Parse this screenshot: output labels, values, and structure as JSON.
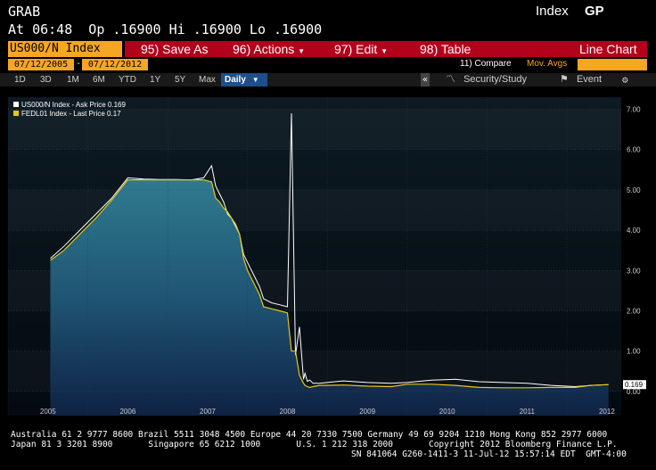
{
  "header": {
    "function": "GRAB",
    "index_label": "Index",
    "gp_label": "GP",
    "quote_line": "At 06:48  Op .16900 Hi .16900 Lo .16900"
  },
  "toolbar": {
    "security": "US000/N Index",
    "save": "95) Save As",
    "actions": "96) Actions",
    "edit": "97) Edit",
    "table": "98) Table",
    "chart_type": "Line Chart"
  },
  "dates": {
    "start": "07/12/2005",
    "end": "07/12/2012",
    "compare": "11) Compare",
    "mov_avgs": "Mov. Avgs"
  },
  "periods": {
    "items": [
      "1D",
      "3D",
      "1M",
      "6M",
      "YTD",
      "1Y",
      "5Y",
      "Max"
    ],
    "frequency": "Daily",
    "collapse": "«",
    "security_study": "Security/Study",
    "event": "Event",
    "gear": "⚙"
  },
  "colors": {
    "toolbar_red": "#b3001b",
    "orange": "#f5a623",
    "series1": "#ffffff",
    "series2": "#e6c619",
    "fill_top": "#2b6f83",
    "fill_bottom": "#0f2244",
    "plot_bg": "#07111a"
  },
  "chart_data": {
    "type": "line",
    "legend": [
      {
        "name": "US000/N Index - Ask Price 0.169",
        "color": "#ffffff"
      },
      {
        "name": "FEDL01 Index - Last Price 0.17",
        "color": "#e6c619"
      }
    ],
    "x_ticks": [
      "2005",
      "2006",
      "2007",
      "2008",
      "2009",
      "2010",
      "2011",
      "2012"
    ],
    "y_ticks": [
      "7.00",
      "6.00",
      "5.00",
      "4.00",
      "3.00",
      "2.00",
      "1.00",
      "0.00"
    ],
    "ylim": [
      -0.6,
      7.3
    ],
    "last_value_label": "0.169",
    "series": [
      {
        "name": "US000/N Index - Ask Price 0.169",
        "x": [
          2005.53,
          2005.7,
          2005.9,
          2006.1,
          2006.3,
          2006.5,
          2006.7,
          2006.9,
          2007.1,
          2007.3,
          2007.45,
          2007.55,
          2007.6,
          2007.65,
          2007.7,
          2007.75,
          2007.8,
          2007.85,
          2007.9,
          2007.95,
          2008.0,
          2008.05,
          2008.1,
          2008.15,
          2008.2,
          2008.3,
          2008.4,
          2008.5,
          2008.55,
          2008.6,
          2008.65,
          2008.7,
          2008.72,
          2008.75,
          2008.78,
          2008.82,
          2008.9,
          2009.0,
          2009.2,
          2009.5,
          2009.8,
          2010.0,
          2010.3,
          2010.6,
          2010.9,
          2011.2,
          2011.5,
          2011.8,
          2012.1,
          2012.3,
          2012.52
        ],
        "y": [
          3.3,
          3.6,
          4.0,
          4.4,
          4.8,
          5.3,
          5.27,
          5.26,
          5.26,
          5.25,
          5.3,
          5.6,
          5.1,
          4.9,
          4.7,
          4.4,
          4.3,
          4.1,
          3.9,
          3.4,
          3.2,
          3.0,
          2.8,
          2.6,
          2.3,
          2.2,
          2.15,
          2.1,
          6.9,
          0.9,
          1.6,
          0.3,
          0.45,
          0.25,
          0.28,
          0.2,
          0.2,
          0.22,
          0.26,
          0.22,
          0.2,
          0.22,
          0.28,
          0.3,
          0.24,
          0.22,
          0.2,
          0.15,
          0.12,
          0.15,
          0.169
        ]
      },
      {
        "name": "FEDL01 Index - Last Price 0.17",
        "x": [
          2005.53,
          2005.7,
          2005.9,
          2006.1,
          2006.3,
          2006.5,
          2006.7,
          2006.9,
          2007.1,
          2007.3,
          2007.45,
          2007.55,
          2007.6,
          2007.65,
          2007.7,
          2007.75,
          2007.8,
          2007.85,
          2007.9,
          2007.95,
          2008.0,
          2008.05,
          2008.1,
          2008.15,
          2008.2,
          2008.3,
          2008.4,
          2008.5,
          2008.55,
          2008.6,
          2008.65,
          2008.7,
          2008.72,
          2008.75,
          2008.78,
          2008.82,
          2008.9,
          2009.0,
          2009.2,
          2009.5,
          2009.8,
          2010.0,
          2010.3,
          2010.6,
          2010.9,
          2011.2,
          2011.5,
          2011.8,
          2012.1,
          2012.3,
          2012.52
        ],
        "y": [
          3.25,
          3.5,
          3.9,
          4.3,
          4.75,
          5.25,
          5.25,
          5.25,
          5.25,
          5.25,
          5.25,
          5.2,
          4.8,
          4.7,
          4.55,
          4.45,
          4.3,
          4.15,
          3.9,
          3.3,
          3.0,
          2.8,
          2.6,
          2.4,
          2.1,
          2.05,
          2.0,
          1.95,
          1.0,
          1.0,
          0.4,
          0.2,
          0.15,
          0.12,
          0.1,
          0.12,
          0.15,
          0.15,
          0.16,
          0.13,
          0.12,
          0.18,
          0.18,
          0.15,
          0.1,
          0.09,
          0.09,
          0.1,
          0.1,
          0.15,
          0.17
        ]
      }
    ]
  },
  "footer": {
    "line1": "Australia 61 2 9777 8600 Brazil 5511 3048 4500 Europe 44 20 7330 7500 Germany 49 69 9204 1210 Hong Kong 852 2977 6000",
    "line2": "Japan 81 3 3201 8900       Singapore 65 6212 1000       U.S. 1 212 318 2000       Copyright 2012 Bloomberg Finance L.P.",
    "line3": "SN 841064 G260-1411-3 11-Jul-12 15:57:14 EDT  GMT-4:00"
  }
}
